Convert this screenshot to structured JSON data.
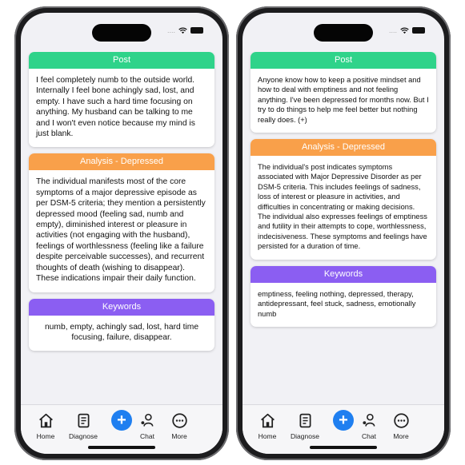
{
  "left_phone": {
    "post": {
      "title": "Post",
      "text": "I feel completely numb to the outside world. Internally I feel bone achingly sad, lost, and empty. I have such a hard time focusing on anything. My husband can be talking to me and I won't even notice because my mind is just blank."
    },
    "analysis": {
      "title": "Analysis - Depressed",
      "text": "The individual manifests most of the core symptoms of a major depressive episode as per DSM-5 criteria; they mention a persistently depressed mood (feeling sad, numb and empty), diminished interest or pleasure in activities (not engaging with the husband), feelings of worthlessness (feeling like a failure despite perceivable successes), and recurrent thoughts of death (wishing to disappear). These indications impair their daily function."
    },
    "keywords": {
      "title": "Keywords",
      "text": "numb, empty, achingly sad, lost, hard time focusing, failure, disappear."
    }
  },
  "right_phone": {
    "post": {
      "title": "Post",
      "text": "Anyone know how to keep a positive mindset and how to deal with emptiness and not feeling anything. I've been depressed for months now. But I try to do things to help me feel better but nothing really does. (+)"
    },
    "analysis": {
      "title": "Analysis - Depressed",
      "text": "The individual's post indicates symptoms associated with Major Depressive Disorder as per DSM-5 criteria. This includes feelings of sadness, loss of interest or pleasure in activities, and difficulties in concentrating or making decisions. The individual also expresses feelings of emptiness and futility in their attempts to cope, worthlessness, indecisiveness. These symptoms and feelings have persisted for a duration of time."
    },
    "keywords": {
      "title": "Keywords",
      "text": "emptiness, feeling nothing, depressed, therapy, antidepressant, feel stuck, sadness, emotionally numb"
    }
  },
  "tabbar": {
    "home": "Home",
    "diagnose": "Diagnose",
    "add": "+",
    "chat": "Chat",
    "more": "More"
  },
  "status": {
    "signal": "...."
  },
  "colors": {
    "post_header": "#2fd38a",
    "analysis_header": "#f9a04a",
    "keywords_header": "#8b5ef2",
    "add_button": "#1f7ff0"
  }
}
